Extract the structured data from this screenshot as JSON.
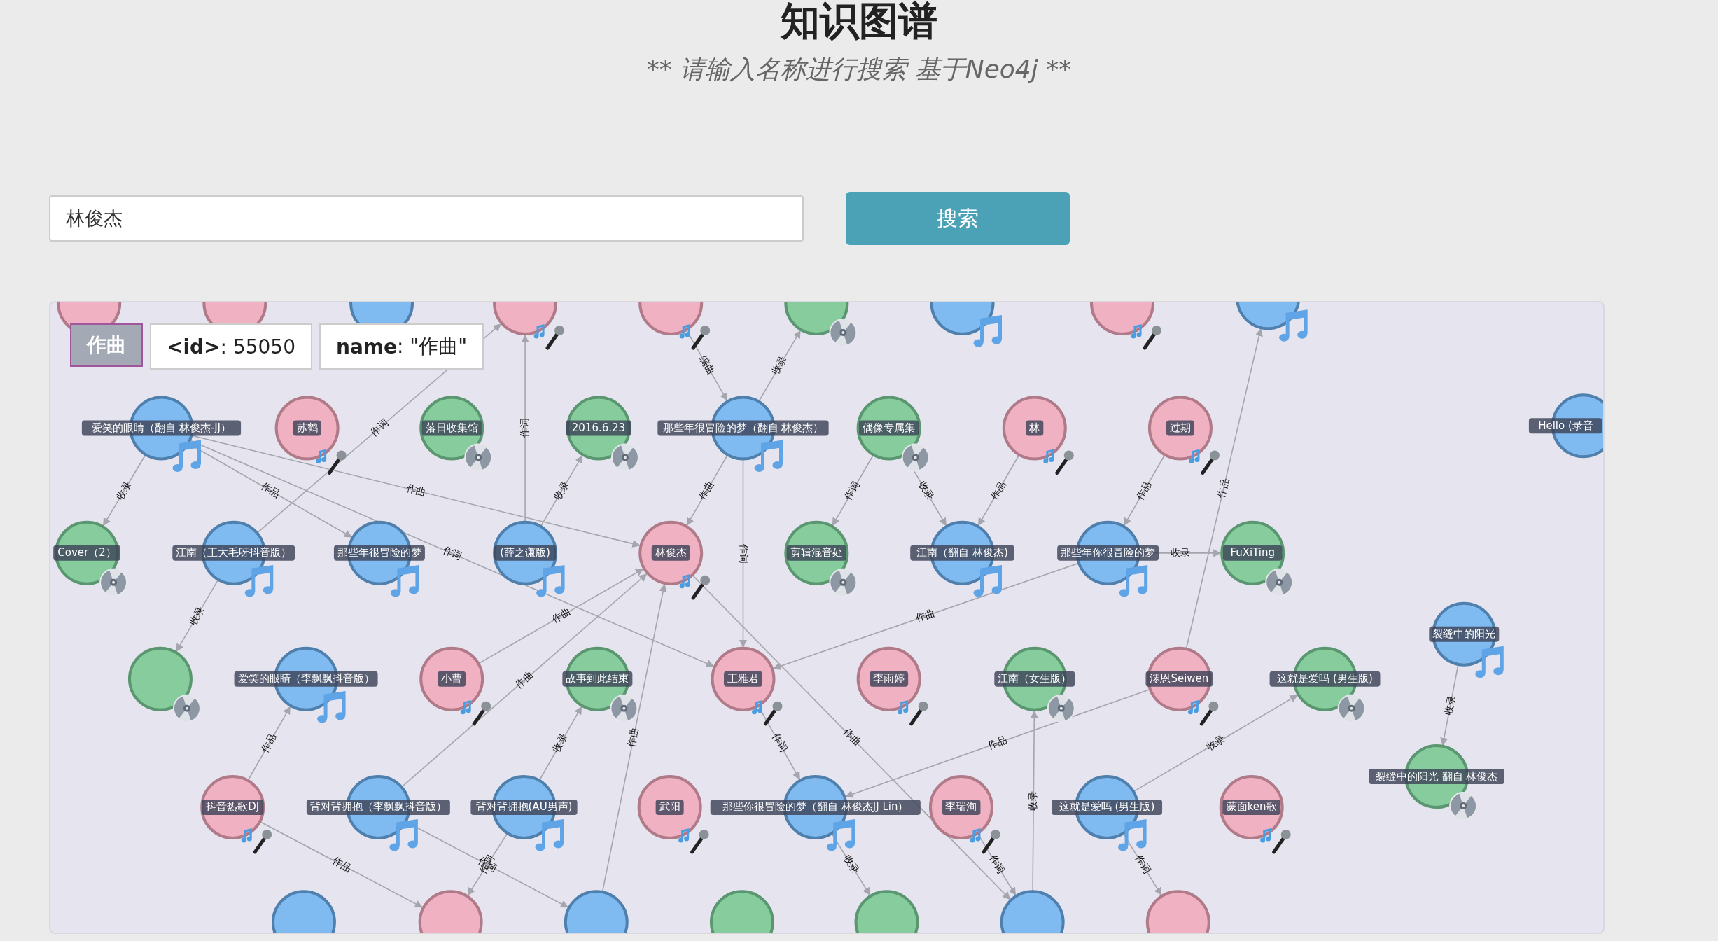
{
  "header": {
    "title": "知识图谱",
    "subtitle": "** 请输入名称进行搜索 基于Neo4j **"
  },
  "search": {
    "value": "林俊杰",
    "button": "搜索"
  },
  "graph": {
    "tooltip": {
      "type": "作曲",
      "id": "**<id>**: 55050",
      "name": "**name**: \"作曲\""
    },
    "nodes": [
      {
        "kind": "singer"
      },
      {
        "kind": "singer"
      },
      {
        "kind": "song"
      },
      {
        "kind": "singer"
      },
      {
        "kind": "singer"
      },
      {
        "kind": "album"
      },
      {
        "kind": "song"
      },
      {
        "kind": "singer"
      },
      {
        "kind": "song"
      },
      {
        "kind": "song",
        "label": "爱笑的眼睛（翻自 林俊杰-JJ）"
      },
      {
        "kind": "singer",
        "label": "苏鹤"
      },
      {
        "kind": "album",
        "label": "落日收集馆"
      },
      {
        "kind": "album",
        "label": "2016.6.23"
      },
      {
        "kind": "song",
        "label": "那些年很冒险的梦（翻自 林俊杰）"
      },
      {
        "kind": "album",
        "label": "偶像专属集"
      },
      {
        "kind": "singer",
        "label": "林"
      },
      {
        "kind": "singer",
        "label": "过期"
      },
      {
        "kind": "song",
        "label": "Hello (录音"
      },
      {
        "kind": "album",
        "label": "Cover（2）"
      },
      {
        "kind": "song",
        "label": "江南（王大毛呀抖音版）"
      },
      {
        "kind": "song",
        "label": "那些年很冒险的梦"
      },
      {
        "kind": "song",
        "label": "(薛之谦版)"
      },
      {
        "kind": "singer",
        "label": "林俊杰"
      },
      {
        "kind": "album",
        "label": "剪辑混音处"
      },
      {
        "kind": "song",
        "label": "江南（翻自 林俊杰)"
      },
      {
        "kind": "song",
        "label": "那些年你很冒险的梦"
      },
      {
        "kind": "album",
        "label": "FuXiTing"
      },
      {
        "kind": "song",
        "label": "裂缝中的阳光"
      },
      {
        "kind": "album"
      },
      {
        "kind": "song",
        "label": "爱笑的眼睛（李飘飘抖音版）"
      },
      {
        "kind": "singer",
        "label": "小曹"
      },
      {
        "kind": "album",
        "label": "故事到此结束"
      },
      {
        "kind": "singer",
        "label": "王雅君"
      },
      {
        "kind": "singer",
        "label": "李雨婷"
      },
      {
        "kind": "album",
        "label": "江南（女生版）"
      },
      {
        "kind": "singer",
        "label": "澪恩Seiwen"
      },
      {
        "kind": "album",
        "label": "这就是爱吗 (男生版)"
      },
      {
        "kind": "album",
        "label": "裂缝中的阳光 翻自 林俊杰"
      },
      {
        "kind": "singer",
        "label": "抖音热歌DJ"
      },
      {
        "kind": "song",
        "label": "背对背拥抱（李飘飘抖音版）"
      },
      {
        "kind": "song",
        "label": "背对背拥抱(AU男声)"
      },
      {
        "kind": "singer",
        "label": "武阳"
      },
      {
        "kind": "song",
        "label": "那些你很冒险的梦（翻自 林俊杰JJ Lin）"
      },
      {
        "kind": "singer",
        "label": "李瑞洵"
      },
      {
        "kind": "song",
        "label": "这就是爱吗 (男生版)"
      },
      {
        "kind": "singer",
        "label": "蒙面ken歌"
      },
      {
        "kind": "song"
      },
      {
        "kind": "singer"
      },
      {
        "kind": "song"
      },
      {
        "kind": "album"
      },
      {
        "kind": "album"
      },
      {
        "kind": "song"
      },
      {
        "kind": "singer"
      }
    ],
    "edges": [
      {
        "label": "收录"
      },
      {
        "label": "作品"
      },
      {
        "label": "作曲"
      },
      {
        "label": "作词"
      },
      {
        "label": "作词"
      },
      {
        "label": "编曲"
      },
      {
        "label": "收录"
      },
      {
        "label": "作曲"
      },
      {
        "label": "收录"
      },
      {
        "label": "作词"
      },
      {
        "label": "作词"
      },
      {
        "label": "收录"
      },
      {
        "label": "作品"
      },
      {
        "label": "作品"
      },
      {
        "label": "作品"
      },
      {
        "label": "收录"
      },
      {
        "label": "收录"
      },
      {
        "label": "收录"
      },
      {
        "label": "作品"
      },
      {
        "label": "作品"
      },
      {
        "label": "作曲"
      },
      {
        "label": "作曲"
      },
      {
        "label": "收录"
      },
      {
        "label": "作曲"
      },
      {
        "label": "作词"
      },
      {
        "label": "作词"
      },
      {
        "label": "作词"
      },
      {
        "label": "作曲"
      },
      {
        "label": "收录"
      },
      {
        "label": "收录"
      },
      {
        "label": "收录"
      },
      {
        "label": "作词"
      },
      {
        "label": "作词"
      },
      {
        "label": "作品"
      },
      {
        "label": "作词"
      },
      {
        "label": "作曲"
      }
    ]
  }
}
